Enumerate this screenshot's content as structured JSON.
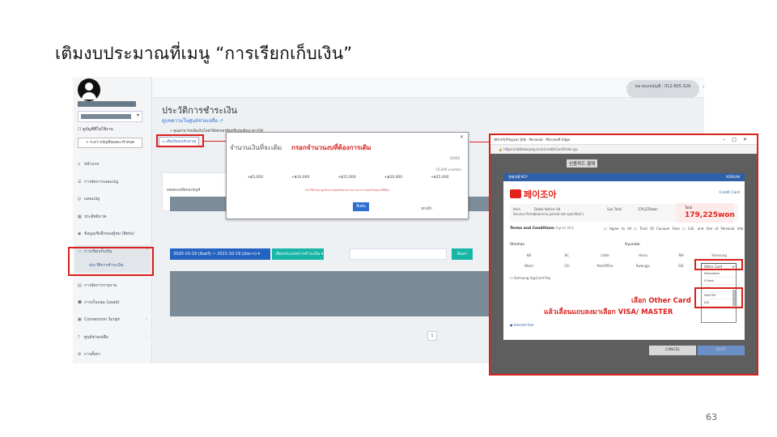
{
  "slide": {
    "title": "เติมงบประมาณที่เมนู “การเรียกเก็บเงิน”",
    "page_number": "63"
  },
  "app": {
    "sidebar": {
      "checkbox_label": "ดูบัญชีที่ไม่ใช้งาน",
      "add_button": "+ ระหว่างบัญชีของตะกร้าคนค",
      "items": [
        {
          "label": "หน้าแรก",
          "icon": "home-icon"
        },
        {
          "label": "การจัดการแคมเปญ",
          "icon": "list-icon"
        },
        {
          "label": "แคมเปญ",
          "icon": "target-icon"
        },
        {
          "label": "ประสิทธิภาพ",
          "icon": "chart-icon"
        },
        {
          "label": "ข้อมูลเชิงลึกของผู้ชม (Beta)",
          "icon": "eye-icon"
        },
        {
          "label": "การเรียกเก็บเงิน",
          "icon": "card-icon"
        },
        {
          "label": "การจัดการรายงาน",
          "icon": "report-icon"
        },
        {
          "label": "การเก็บกลุ่ม (Lead)",
          "icon": "people-icon"
        },
        {
          "label": "Conversion Script",
          "icon": "code-icon"
        },
        {
          "label": "ศูนย์ช่วยเหลือ",
          "icon": "help-icon"
        },
        {
          "label": "การตั้งค่า",
          "icon": "gear-icon"
        }
      ],
      "active_sub": "ประวัติการชำระเงิน"
    },
    "topbar": {
      "balance": "หมายเลขบัญชี : 012-805-329"
    },
    "main": {
      "title": "ประวัติการชำระเงิน",
      "help_link": "ดูบทความในศูนย์ช่วยเหลือ",
      "bullet": "คุณสามารถเติมเงินโดยใช้บัตรเครดิตหรือบัญชีธนาคารได้",
      "topup_button": "เติมเงินงบประมาณ",
      "card_text": "ยอดคงเหลือของบัญชี",
      "date_range": "2020-10-19 (จันทร์) ~ 2021-10-19 (อังคาร) ▾",
      "filter": "เลือกประเภทการชำระเงิน ▾",
      "search_button": "ค้นหา",
      "page": "1"
    }
  },
  "modal": {
    "label": "จำนวนเงินที่จะเติม",
    "hint": "กรอกจำนวนงบที่ต้องการเติม",
    "min_value": "10000",
    "unit": "10,000 บาท/min",
    "amounts": [
      "+฿5,000",
      "+฿10,000",
      "+฿15,000",
      "+฿20,000",
      "+฿25,000"
    ],
    "note": "*ค่าใช้จ่ายจะถูกหักจากยอดเงินตามระยะเวลาการแสดงโฆษณาที่เลือก",
    "cancel": "ยกเลิก",
    "ok": "ยืนยัน"
  },
  "popup": {
    "window_title": "페이조아(Payjoa) 결제 - Personal - Microsoft Edge",
    "url": "https://settlekorpay.co.kr/credit/CardOrder.jsp",
    "heading": "신용카드 결제",
    "header_left": "결제대행 KCP",
    "header_right": "KOREAN",
    "logo_text": "페이조아",
    "credit_card_label": "Credit Card",
    "item_label": "Item",
    "item_value": "Dable Native Ad",
    "service_label": "Service Period",
    "service_value": "( service period not specified )",
    "subtotal_label": "Sub Total",
    "subtotal_value": "179,225won",
    "total_label": "Total",
    "total_value": "179,225won",
    "terms_label": "Terms and Conditions",
    "terms_sub": "Agree Not",
    "terms_opts": "☐ Agree to All   ☐ Trust Of Consum Fees   ☐ Coll. and Use of Personal Info",
    "shinhan_label": "Shinhan",
    "hyundai_label": "Hyundai",
    "cards_row1": [
      "KB",
      "BC",
      "Lotte",
      "Hana",
      "NH",
      "Samsung"
    ],
    "cards_row2": [
      "Woori",
      "Citi",
      "PostOffice",
      "Kwangju",
      "SIG"
    ],
    "dropdown_value": "Other Card",
    "dropdown_options": [
      "Kakaobank",
      "K Bank",
      "VISA",
      "MASTER",
      "JCB"
    ],
    "samsung_pay": "Samsung AppCard Pay",
    "kakao_link": "Interest-free",
    "cancel_button": "CANCEL",
    "next_button": "NEXT"
  },
  "annotations": {
    "select_other": "เลือก Other Card",
    "select_visa": "แล้วเลื่อนแถบลงมาเลือก VISA/ MASTER"
  }
}
